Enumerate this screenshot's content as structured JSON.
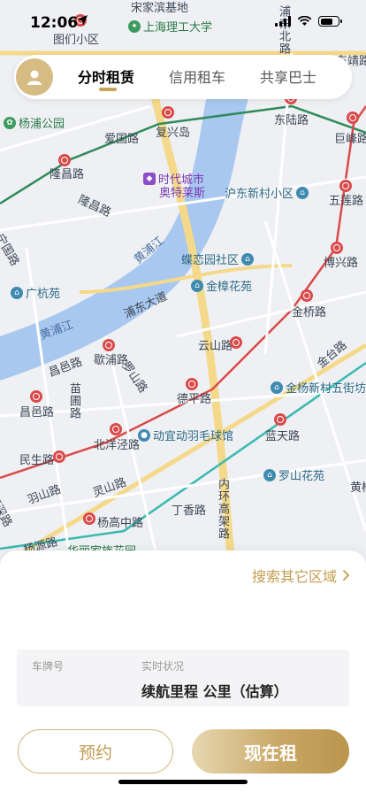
{
  "status_bar": {
    "time": "12:06"
  },
  "tabs": [
    {
      "label": "分时租赁",
      "active": true
    },
    {
      "label": "信用租车",
      "active": false
    },
    {
      "label": "共享巴士",
      "active": false
    }
  ],
  "map": {
    "labels": {
      "l1": "宋家滨基地",
      "l2": "上海理工大学",
      "l3": "图们小区",
      "l4": "浦东北路",
      "l5": "东靖路",
      "l6": "杨浦公园",
      "l7": "爱国路",
      "l8": "复兴岛",
      "l9": "东陆路",
      "l10": "巨峰路",
      "l11": "隆昌路",
      "l12": "隆昌路",
      "l13": "时代城市",
      "l14": "奥特莱斯",
      "l15": "沪东新村小区",
      "l16": "五莲路",
      "l17": "宁国路",
      "l18": "黄浦江",
      "l19": "蝶恋园社区",
      "l20": "博兴路",
      "l21": "广杭苑",
      "l22": "金樟花苑",
      "l23": "浦东大道",
      "l24": "金桥路",
      "l25": "黄浦江",
      "l26": "歇浦路",
      "l27": "云山路",
      "l28": "金台路",
      "l29": "昌邑路",
      "l30": "罗山路",
      "l31": "苗圃路",
      "l32": "德平路",
      "l33": "金杨新村五街坊",
      "l34": "昌邑路",
      "l35": "动宜动羽毛球馆",
      "l36": "蓝天路",
      "l37": "民生路",
      "l38": "北洋泾路",
      "l39": "罗山花苑",
      "l40": "羽山路",
      "l41": "灵山路",
      "l42": "内环高架路",
      "l43": "黄杨",
      "l44": "源深路",
      "l45": "杨高中路",
      "l46": "丁香路",
      "l47": "杨源路",
      "l48": "华丽家族花园"
    }
  },
  "sheet": {
    "search_other": "搜索其它区域",
    "plate_label": "车牌号",
    "status_label": "实时状况",
    "status_value": "续航里程 公里（估算）",
    "reserve_button": "预约",
    "rent_button": "现在租"
  },
  "colors": {
    "gold": "#c29c4f",
    "metro_red": "#d94a4a",
    "river": "#a8c8ef"
  }
}
